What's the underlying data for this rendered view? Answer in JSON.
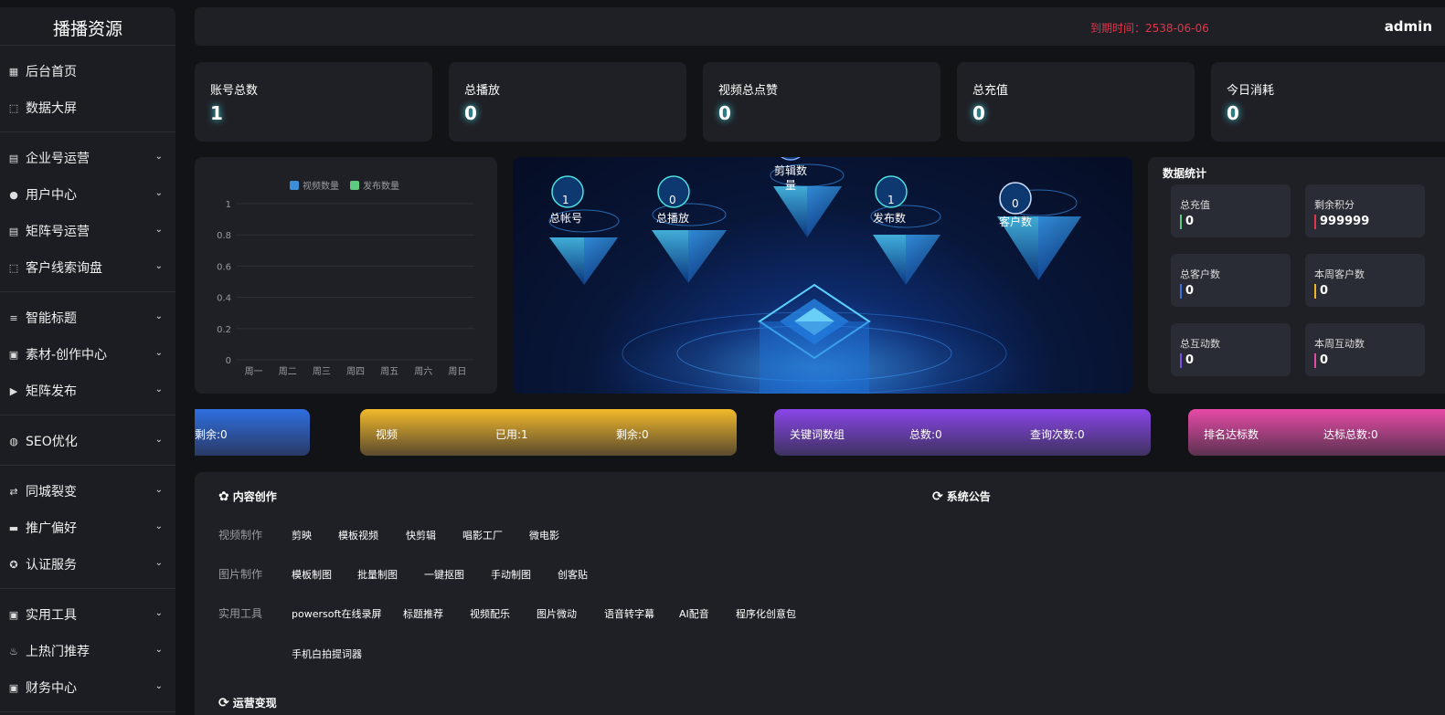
{
  "brand": "播播资源",
  "nav": [
    [
      {
        "icon": "▦",
        "label": "后台首页"
      },
      {
        "icon": "⬚",
        "label": "数据大屏"
      }
    ],
    [
      {
        "icon": "▤",
        "label": "企业号运营"
      },
      {
        "icon": "●",
        "label": "用户中心"
      },
      {
        "icon": "▤",
        "label": "矩阵号运营"
      },
      {
        "icon": "⬚",
        "label": "客户线索询盘"
      }
    ],
    [
      {
        "icon": "≡",
        "label": "智能标题"
      },
      {
        "icon": "▣",
        "label": "素材-创作中心"
      },
      {
        "icon": "▶",
        "label": "矩阵发布"
      }
    ],
    [
      {
        "icon": "◍",
        "label": "SEO优化"
      }
    ],
    [
      {
        "icon": "⇄",
        "label": "同城裂变"
      },
      {
        "icon": "▬",
        "label": "推广偏好"
      },
      {
        "icon": "✪",
        "label": "认证服务"
      }
    ],
    [
      {
        "icon": "▣",
        "label": "实用工具"
      },
      {
        "icon": "♨",
        "label": "上热门推荐"
      },
      {
        "icon": "▣",
        "label": "财务中心"
      }
    ]
  ],
  "topbar": {
    "expire": "到期时间：2538-06-06",
    "user": "admin"
  },
  "stats": [
    {
      "label": "账号总数",
      "value": "1"
    },
    {
      "label": "总播放",
      "value": "0"
    },
    {
      "label": "视频总点赞",
      "value": "0"
    },
    {
      "label": "总充值",
      "value": "0"
    },
    {
      "label": "今日消耗",
      "value": "0"
    }
  ],
  "chart_data": {
    "type": "bar",
    "categories": [
      "周一",
      "周二",
      "周三",
      "周四",
      "周五",
      "周六",
      "周日"
    ],
    "series": [
      {
        "name": "视频数量",
        "values": [
          0,
          0,
          0,
          0,
          0,
          0,
          0
        ],
        "color": "#3b8fd9"
      },
      {
        "name": "发布数量",
        "values": [
          0,
          0,
          0,
          0,
          0,
          0,
          0
        ],
        "color": "#5ec97f"
      }
    ],
    "yticks": [
      "1",
      "0.8",
      "0.6",
      "0.4",
      "0.2",
      "0"
    ],
    "ylim": [
      0,
      1
    ],
    "legend": "top",
    "grid": true
  },
  "center": [
    {
      "label": "总帐号",
      "value": "1"
    },
    {
      "label": "总播放",
      "value": "0"
    },
    {
      "label": "剪辑数",
      "label2": "量",
      "value": "0"
    },
    {
      "label": "发布数",
      "value": "1"
    },
    {
      "label": "客户数",
      "value": "0"
    }
  ],
  "datastat": {
    "title": "数据统计",
    "cards": [
      {
        "label": "总充值",
        "value": "0",
        "color": "#5ec97f"
      },
      {
        "label": "剩余积分",
        "value": "999999",
        "color": "#e0354a"
      },
      {
        "label": "总客户数",
        "value": "0",
        "color": "#3b6fd9"
      },
      {
        "label": "本周客户数",
        "value": "0",
        "color": "#f0b429"
      },
      {
        "label": "总互动数",
        "value": "0",
        "color": "#7c4de8"
      },
      {
        "label": "本周互动数",
        "value": "0",
        "color": "#e04aa8"
      }
    ]
  },
  "banners": [
    {
      "texts": [
        "剩余:0"
      ]
    },
    {
      "texts": [
        "视频",
        "已用:1",
        "剩余:0"
      ]
    },
    {
      "texts": [
        "关键词数组",
        "总数:0",
        "查询次数:0"
      ]
    },
    {
      "texts": [
        "排名达标数",
        "达标总数:0"
      ]
    }
  ],
  "content": {
    "title": "内容创作",
    "notice": "系统公告",
    "ops": "运营变现",
    "rows": [
      {
        "label": "视频制作",
        "links": [
          "剪映",
          "模板视频",
          "快剪辑",
          "唱影工厂",
          "微电影"
        ]
      },
      {
        "label": "图片制作",
        "links": [
          "模板制图",
          "批量制图",
          "一键抠图",
          "手动制图",
          "创客贴"
        ]
      },
      {
        "label": "实用工具",
        "links": [
          "powersoft在线录屏",
          "标题推荐",
          "视频配乐",
          "图片微动",
          "语音转字幕",
          "AI配音",
          "程序化创意包"
        ]
      },
      {
        "label": "",
        "links": [
          "手机白拍提词器"
        ]
      }
    ]
  }
}
